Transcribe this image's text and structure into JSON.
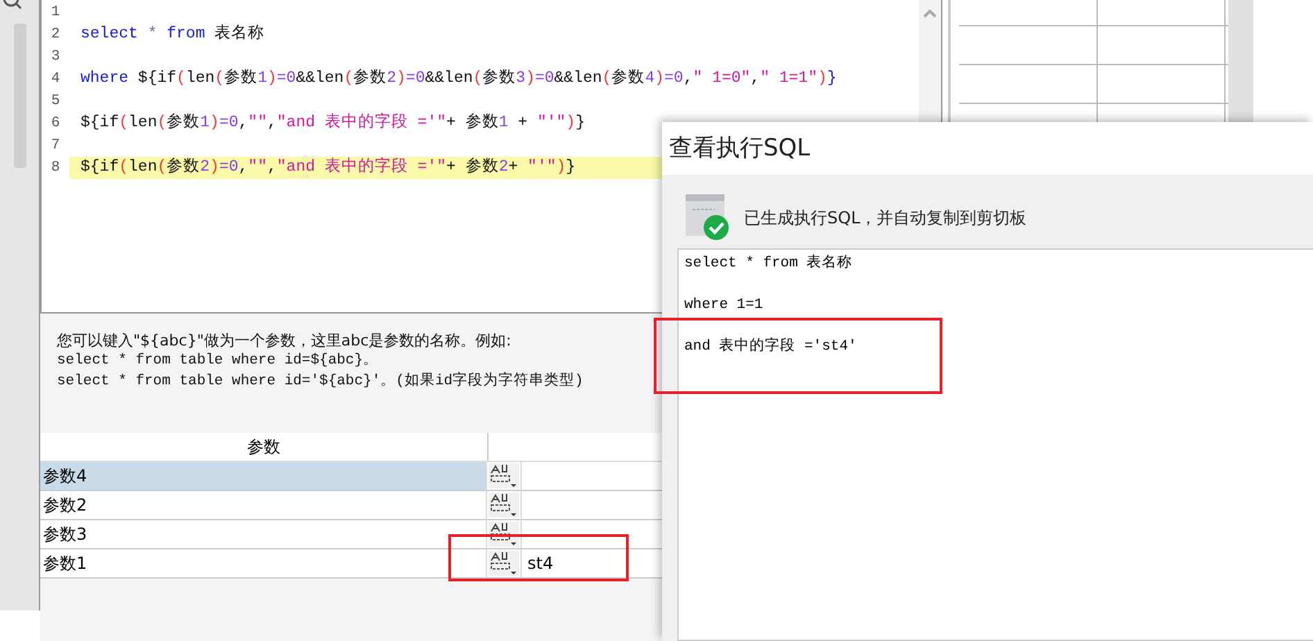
{
  "editor": {
    "lines": [
      {
        "number": "1",
        "highlighted": false
      },
      {
        "number": "2",
        "highlighted": false,
        "tokens": [
          {
            "color": "#1818e0",
            "t": "select "
          },
          {
            "color": "#8060b0",
            "t": "* "
          },
          {
            "color": "#1818e0",
            "t": "from "
          },
          {
            "color": "#111111",
            "t": "表名称"
          }
        ]
      },
      {
        "number": "3",
        "highlighted": false
      },
      {
        "number": "4",
        "highlighted": false,
        "tokens": [
          {
            "color": "#1818e0",
            "t": "where "
          },
          {
            "color": "#111111",
            "t": "${if"
          },
          {
            "color": "#f03838",
            "t": "("
          },
          {
            "color": "#111111",
            "t": "len"
          },
          {
            "color": "#f03838",
            "t": "("
          },
          {
            "color": "#111111",
            "t": "参数"
          },
          {
            "color": "#8a3ee8",
            "t": "1"
          },
          {
            "color": "#f03838",
            "t": ")"
          },
          {
            "color": "#8a3ee8",
            "t": "=0"
          },
          {
            "color": "#111111",
            "t": "&&len"
          },
          {
            "color": "#f03838",
            "t": "("
          },
          {
            "color": "#111111",
            "t": "参数"
          },
          {
            "color": "#8a3ee8",
            "t": "2"
          },
          {
            "color": "#f03838",
            "t": ")"
          },
          {
            "color": "#8a3ee8",
            "t": "=0"
          },
          {
            "color": "#111111",
            "t": "&&len"
          },
          {
            "color": "#f03838",
            "t": "("
          },
          {
            "color": "#111111",
            "t": "参数"
          },
          {
            "color": "#8a3ee8",
            "t": "3"
          },
          {
            "color": "#f03838",
            "t": ")"
          },
          {
            "color": "#8a3ee8",
            "t": "=0"
          },
          {
            "color": "#111111",
            "t": "&&len"
          },
          {
            "color": "#f03838",
            "t": "("
          },
          {
            "color": "#111111",
            "t": "参数"
          },
          {
            "color": "#8a3ee8",
            "t": "4"
          },
          {
            "color": "#f03838",
            "t": ")"
          },
          {
            "color": "#8a3ee8",
            "t": "=0"
          },
          {
            "color": "#111111",
            "t": ","
          },
          {
            "color": "#d6179e",
            "t": "\" 1=0\""
          },
          {
            "color": "#111111",
            "t": ","
          },
          {
            "color": "#d6179e",
            "t": "\" 1=1\""
          },
          {
            "color": "#f03838",
            "t": ")"
          },
          {
            "color": "#1818e0",
            "t": "}"
          }
        ]
      },
      {
        "number": "5",
        "highlighted": false
      },
      {
        "number": "6",
        "highlighted": false,
        "tokens": [
          {
            "color": "#111111",
            "t": "${if"
          },
          {
            "color": "#f03838",
            "t": "("
          },
          {
            "color": "#111111",
            "t": "len"
          },
          {
            "color": "#f03838",
            "t": "("
          },
          {
            "color": "#111111",
            "t": "参数"
          },
          {
            "color": "#8a3ee8",
            "t": "1"
          },
          {
            "color": "#f03838",
            "t": ")"
          },
          {
            "color": "#8a3ee8",
            "t": "=0"
          },
          {
            "color": "#111111",
            "t": ","
          },
          {
            "color": "#d6179e",
            "t": "\"\""
          },
          {
            "color": "#111111",
            "t": ","
          },
          {
            "color": "#d6179e",
            "t": "\"and 表中的字段 ='\""
          },
          {
            "color": "#111111",
            "t": "+ 参数"
          },
          {
            "color": "#8a3ee8",
            "t": "1"
          },
          {
            "color": "#111111",
            "t": " + "
          },
          {
            "color": "#d6179e",
            "t": "\"'\""
          },
          {
            "color": "#f03838",
            "t": ")"
          },
          {
            "color": "#111111",
            "t": "}"
          }
        ]
      },
      {
        "number": "7",
        "highlighted": false
      },
      {
        "number": "8",
        "highlighted": true,
        "tokens": [
          {
            "color": "#111111",
            "t": "${if"
          },
          {
            "color": "#f03838",
            "t": "("
          },
          {
            "color": "#111111",
            "t": "len"
          },
          {
            "color": "#f03838",
            "t": "("
          },
          {
            "color": "#111111",
            "t": "参数"
          },
          {
            "color": "#8a3ee8",
            "t": "2"
          },
          {
            "color": "#f03838",
            "t": ")"
          },
          {
            "color": "#8a3ee8",
            "t": "=0"
          },
          {
            "color": "#111111",
            "t": ","
          },
          {
            "color": "#d6179e",
            "t": "\"\""
          },
          {
            "color": "#111111",
            "t": ","
          },
          {
            "color": "#d6179e",
            "t": "\"and 表中的字段 ='\""
          },
          {
            "color": "#111111",
            "t": "+ 参数"
          },
          {
            "color": "#8a3ee8",
            "t": "2"
          },
          {
            "color": "#111111",
            "t": "+ "
          },
          {
            "color": "#d6179e",
            "t": "\"'\""
          },
          {
            "color": "#f03838",
            "t": ")"
          },
          {
            "color": "#111111",
            "t": "}"
          }
        ]
      }
    ]
  },
  "help": {
    "lines": [
      "您可以键入\"${abc}\"做为一个参数，这里abc是参数的名称。例如:",
      "select * from table where id=${abc}。",
      "select * from table where id='${abc}'。(如果id字段为字符串类型)"
    ]
  },
  "parameters": {
    "columns": [
      "参数"
    ],
    "rows": [
      {
        "name": "参数4",
        "selected": true,
        "framed": false
      },
      {
        "name": "参数2",
        "selected": false,
        "framed": false
      },
      {
        "name": "参数3",
        "selected": false,
        "framed": false
      },
      {
        "name": "参数1",
        "value": "st4",
        "selected": false,
        "framed": true
      }
    ]
  },
  "dialog": {
    "title": "查看执行SQL",
    "message": "已生成执行SQL，并自动复制到剪切板",
    "result_lines": [
      {
        "text": "select * from 表名称",
        "framed": false
      },
      {
        "text": "where  1=1",
        "framed": false
      },
      {
        "text": "and 表中的字段 ='st4'",
        "framed": true
      }
    ]
  }
}
